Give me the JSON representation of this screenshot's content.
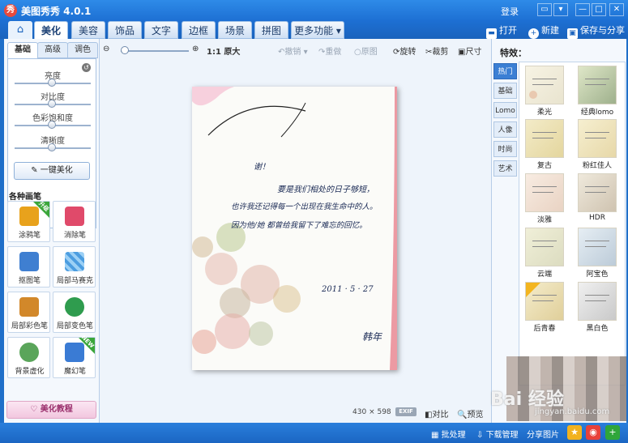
{
  "window": {
    "logo": "秀",
    "title": "美图秀秀 4.0.1",
    "login": "登录",
    "controls": [
      "▭",
      "▾",
      "—",
      "□",
      "✕"
    ]
  },
  "tabs": [
    "美化",
    "美容",
    "饰品",
    "文字",
    "边框",
    "场景",
    "拼图",
    "更多功能"
  ],
  "home_icon": "⌂",
  "actions": [
    {
      "icon": "open-icon",
      "label": "打开"
    },
    {
      "icon": "new-icon",
      "label": "新建"
    },
    {
      "icon": "save-icon",
      "label": "保存与分享"
    }
  ],
  "left": {
    "subtabs": [
      "基础",
      "高级",
      "调色"
    ],
    "sliders": [
      "亮度",
      "对比度",
      "色彩饱和度",
      "清晰度"
    ],
    "auto_button": "一键美化",
    "brush_title": "各种画笔",
    "brushes": [
      {
        "label": "涂鸦笔",
        "badge": "升级",
        "color": "#e8a21c"
      },
      {
        "label": "消除笔",
        "badge": "",
        "color": "#e04a6a"
      },
      {
        "label": "抠图笔",
        "badge": "",
        "color": "#3f7fd1"
      },
      {
        "label": "局部马赛克",
        "badge": "",
        "color": "#4c9de0"
      },
      {
        "label": "局部彩色笔",
        "badge": "",
        "color": "#d2882a"
      },
      {
        "label": "局部变色笔",
        "badge": "",
        "color": "#2f9c4e"
      },
      {
        "label": "背景虚化",
        "badge": "",
        "color": "#5aa55a"
      },
      {
        "label": "魔幻笔",
        "badge": "NEW",
        "color": "#3a7bd4"
      }
    ],
    "tutorial": "美化教程"
  },
  "toolbar": {
    "zoom_out": "🔍−",
    "zoom_in": "🔍+",
    "original_size": "1:1 原大",
    "undo": "撤销",
    "redo": "重做",
    "original": "原图",
    "rotate": "旋转",
    "crop": "裁剪",
    "resize": "尺寸"
  },
  "photo": {
    "lines": [
      "谢！",
      "要是我们相处的日子够短，",
      "也许我还记得每一个出现在我生命中的人。",
      "因为他/她 都曾给我留下了难忘的回忆。",
      "2011 · 5 · 27",
      "韩年"
    ]
  },
  "status": {
    "width": "430",
    "times": "×",
    "height": "598",
    "exif": "EXIF",
    "compare": "对比",
    "preview": "预览"
  },
  "effects": {
    "title": "特效：",
    "categories": [
      "热门",
      "基础",
      "Lomo",
      "人像",
      "时尚",
      "艺术"
    ],
    "items": [
      {
        "label": "柔光",
        "badge": false
      },
      {
        "label": "经典lomo",
        "badge": false
      },
      {
        "label": "复古",
        "badge": false
      },
      {
        "label": "粉红佳人",
        "badge": false
      },
      {
        "label": "淡雅",
        "badge": false
      },
      {
        "label": "HDR",
        "badge": false
      },
      {
        "label": "云端",
        "badge": false
      },
      {
        "label": "阿宝色",
        "badge": false
      },
      {
        "label": "后青春",
        "badge": true
      },
      {
        "label": "黑白色",
        "badge": false
      }
    ]
  },
  "bottom": {
    "batch": "批处理",
    "download": "下载管理",
    "share": "分享图片"
  },
  "watermark": {
    "main": "Bai 经验",
    "sub": "jingyan.baidu.com"
  }
}
